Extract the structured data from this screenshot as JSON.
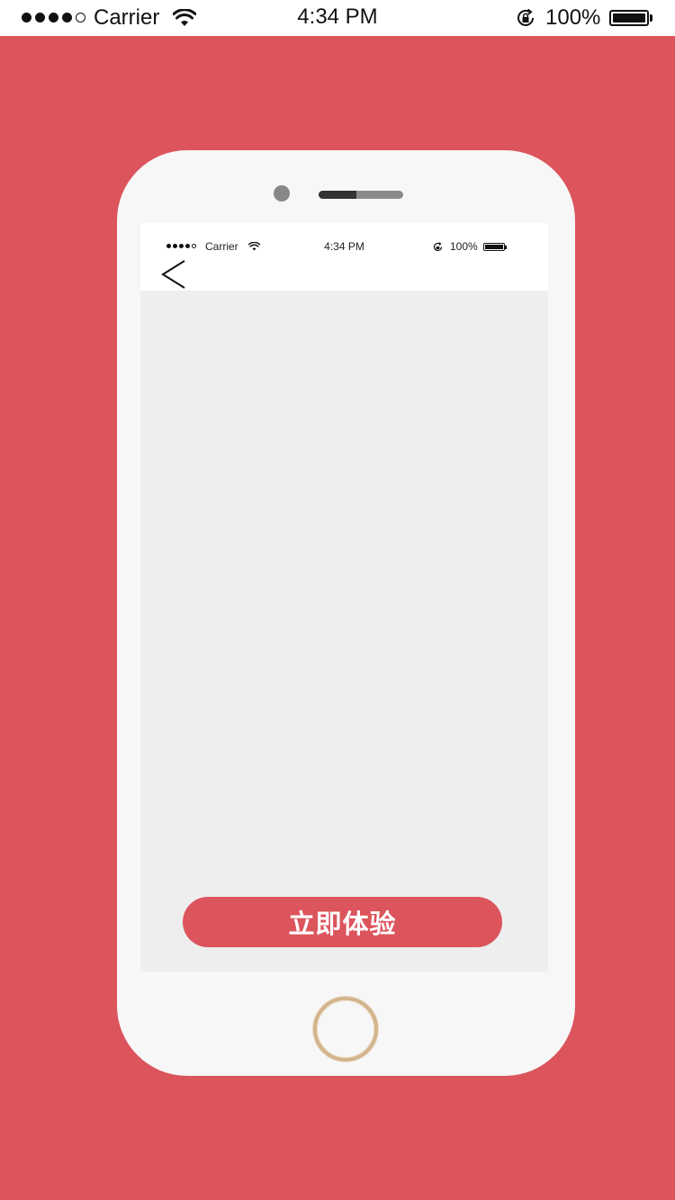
{
  "status_bar": {
    "carrier": "Carrier",
    "time": "4:34 PM",
    "battery_percent": "100%",
    "signal_bars_filled": 4,
    "signal_bars_total": 5
  },
  "mockup": {
    "status_bar": {
      "carrier": "Carrier",
      "time": "4:34 PM",
      "battery_percent": "100%"
    },
    "back_icon": "chevron-left-icon"
  },
  "cta": {
    "label": "立即体验"
  },
  "colors": {
    "background": "#dc545c",
    "accent": "#dc545c",
    "phone_body": "#f7f7f7",
    "screen": "#eeeeee"
  }
}
